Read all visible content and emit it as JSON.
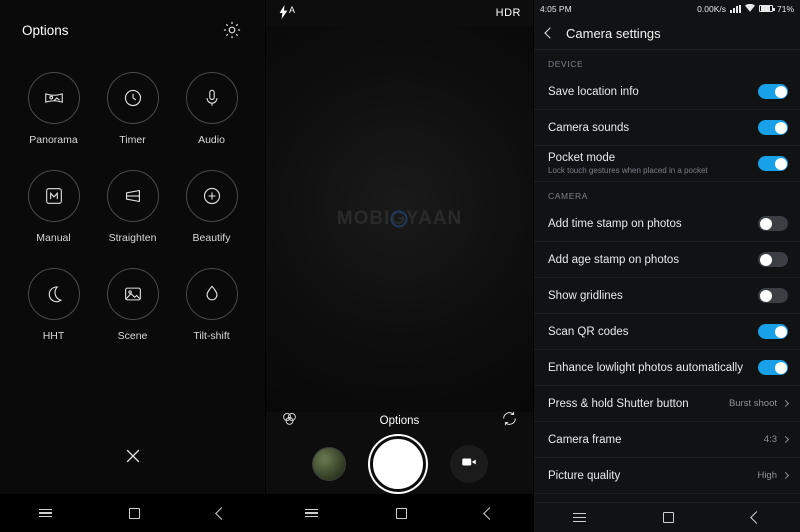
{
  "panel1": {
    "title": "Options",
    "gear_icon": "gear-icon",
    "close_icon": "close-icon",
    "items": [
      {
        "label": "Panorama",
        "icon": "panorama-icon"
      },
      {
        "label": "Timer",
        "icon": "clock-icon"
      },
      {
        "label": "Audio",
        "icon": "microphone-icon"
      },
      {
        "label": "Manual",
        "icon": "manual-m-icon"
      },
      {
        "label": "Straighten",
        "icon": "straighten-icon"
      },
      {
        "label": "Beautify",
        "icon": "beautify-plus-icon"
      },
      {
        "label": "HHT",
        "icon": "moon-icon"
      },
      {
        "label": "Scene",
        "icon": "landscape-icon"
      },
      {
        "label": "Tilt-shift",
        "icon": "droplet-icon"
      }
    ],
    "navbar": [
      "menu-icon",
      "home-icon",
      "back-icon"
    ]
  },
  "panel2": {
    "flash_label": "A",
    "flash_icon": "flash-auto-icon",
    "hdr_label": "HDR",
    "watermark": "MOBIGYAAN",
    "options_label": "Options",
    "left_icon": "filters-icon",
    "right_icon": "switch-camera-icon",
    "thumbnail": "last-photo-thumbnail",
    "shutter": "shutter-button",
    "video_icon": "video-camera-icon",
    "navbar": [
      "menu-icon",
      "home-icon",
      "back-icon"
    ]
  },
  "panel3": {
    "status": {
      "time": "4:05 PM",
      "net_speed": "0.00K/s",
      "battery": "71%",
      "icons": [
        "signal-bars-icon",
        "wifi-icon",
        "battery-icon"
      ]
    },
    "header": {
      "back_icon": "back-arrow-icon",
      "title": "Camera settings"
    },
    "sections": [
      {
        "label": "DEVICE",
        "rows": [
          {
            "main": "Save location info",
            "sub": "",
            "control": "toggle",
            "state": "on"
          },
          {
            "main": "Camera sounds",
            "sub": "",
            "control": "toggle",
            "state": "on"
          },
          {
            "main": "Pocket mode",
            "sub": "Lock touch gestures when placed in a pocket",
            "control": "toggle",
            "state": "on"
          }
        ]
      },
      {
        "label": "CAMERA",
        "rows": [
          {
            "main": "Add time stamp on photos",
            "sub": "",
            "control": "toggle",
            "state": "off"
          },
          {
            "main": "Add age stamp on photos",
            "sub": "",
            "control": "toggle",
            "state": "off"
          },
          {
            "main": "Show gridlines",
            "sub": "",
            "control": "toggle",
            "state": "off"
          },
          {
            "main": "Scan QR codes",
            "sub": "",
            "control": "toggle",
            "state": "on"
          },
          {
            "main": "Enhance lowlight photos automatically",
            "sub": "",
            "control": "toggle",
            "state": "on"
          },
          {
            "main": "Press & hold Shutter button",
            "sub": "",
            "control": "value",
            "value": "Burst shoot"
          },
          {
            "main": "Camera frame",
            "sub": "",
            "control": "value",
            "value": "4:3"
          },
          {
            "main": "Picture quality",
            "sub": "",
            "control": "value",
            "value": "High"
          }
        ]
      }
    ],
    "navbar": [
      "menu-icon",
      "home-icon",
      "back-icon"
    ],
    "accent": "#18a0e8"
  }
}
